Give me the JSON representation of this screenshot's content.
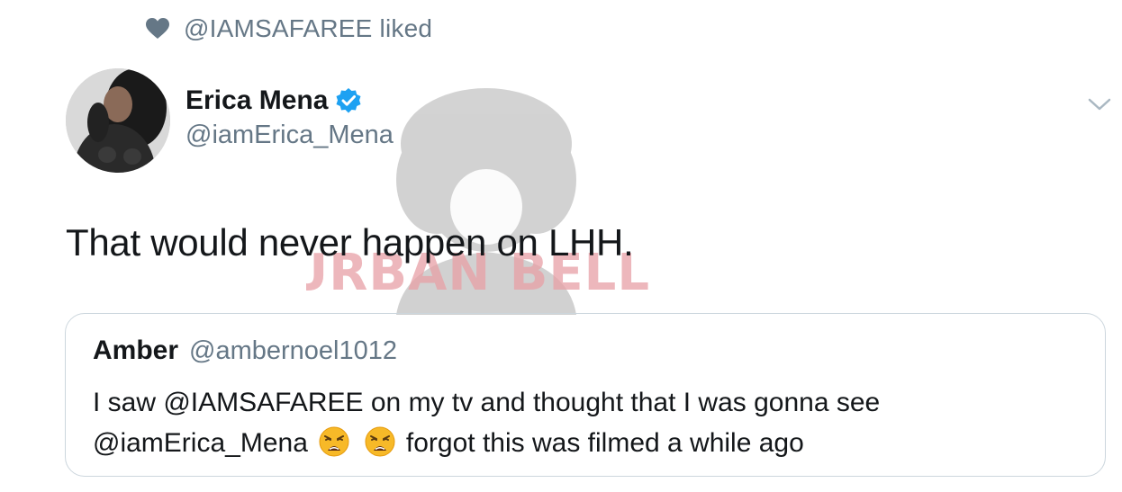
{
  "social_context": {
    "liked_text": "@IAMSAFAREE liked",
    "icon": "heart-icon"
  },
  "author": {
    "name": "Erica Mena",
    "handle": "@iamErica_Mena",
    "verified_icon": "verified-badge-icon",
    "avatar_icon": "avatar"
  },
  "tweet": {
    "text": "That would never happen on LHH."
  },
  "menu": {
    "icon": "chevron-down-icon"
  },
  "watermark": {
    "text": "URBAN BELLE"
  },
  "quoted_tweet": {
    "name": "Amber",
    "handle": "@ambernoel1012",
    "line1": "I saw @IAMSAFAREE on my tv and thought that I was gonna see",
    "line2_prefix": "@iamErica_Mena",
    "line2_suffix": "forgot this was filmed a while ago",
    "emoji": "weary-face-icon"
  },
  "colors": {
    "text_primary": "#14171a",
    "text_secondary": "#657786",
    "verified_blue": "#1da1f2",
    "border": "#ccd6dd",
    "watermark_red": "#e8a0a6"
  }
}
